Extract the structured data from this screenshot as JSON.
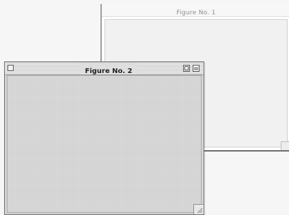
{
  "windows": [
    {
      "id": "figure-1",
      "title": "Figure No. 1",
      "state": "inactive"
    },
    {
      "id": "figure-2",
      "title": "Figure No. 2",
      "state": "active",
      "controls": {
        "close": "close-box-icon",
        "zoom": "zoom-box-icon",
        "collapse": "collapse-box-icon"
      }
    }
  ]
}
